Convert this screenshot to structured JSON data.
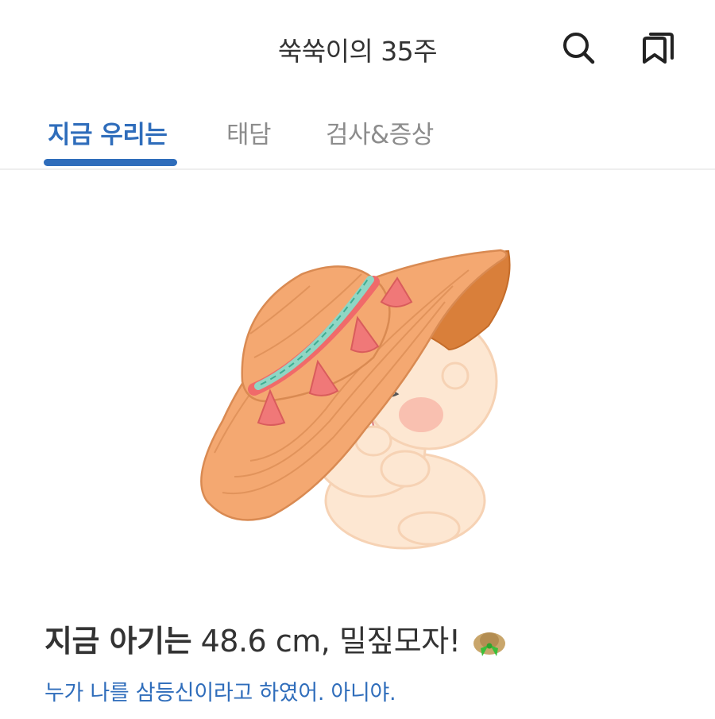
{
  "header": {
    "title": "쑥쑥이의 35주"
  },
  "tabs": [
    {
      "label": "지금 우리는",
      "active": true
    },
    {
      "label": "태담",
      "active": false
    },
    {
      "label": "검사&증상",
      "active": false
    }
  ],
  "icons": {
    "search": "search-icon",
    "bookmark": "bookmarks-icon",
    "hat": "straw-hat-icon"
  },
  "info": {
    "headline_bold": "지금 아기는",
    "headline_rest": "48.6 cm, 밀짚모자!",
    "subtitle": "누가 나를 삼등신이라고 하였어. 아니야."
  },
  "colors": {
    "accent": "#2f6dbb",
    "text": "#333333",
    "inactive_tab": "#8c8c8c"
  }
}
